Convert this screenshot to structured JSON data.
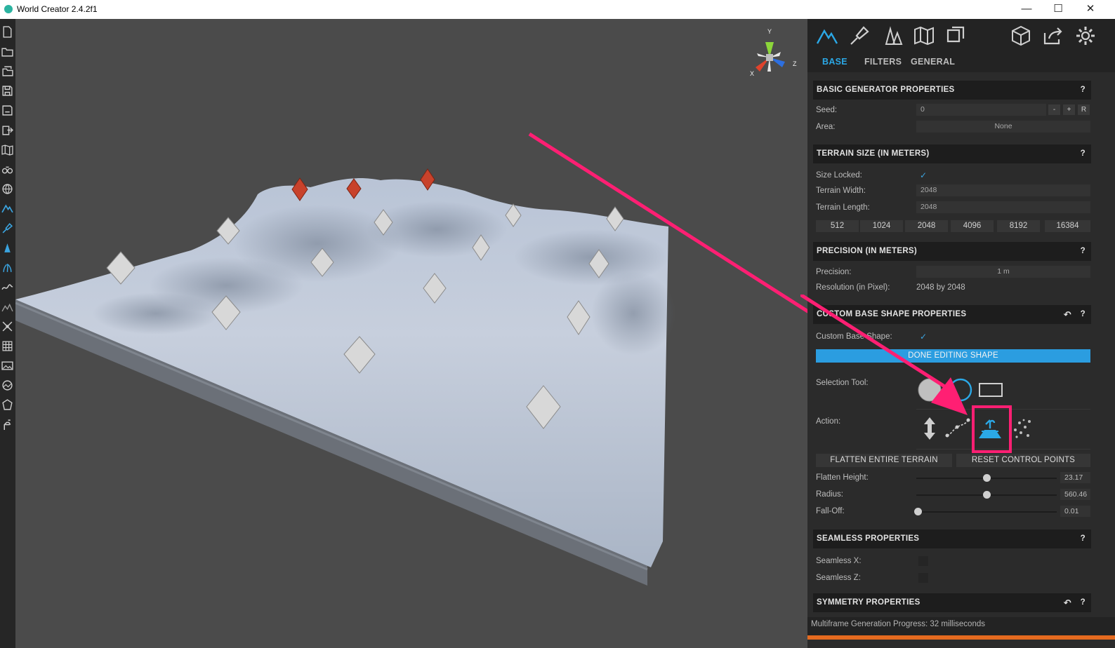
{
  "window": {
    "title": "World Creator 2.4.2f1",
    "minimize": "—",
    "maximize": "☐",
    "close": "✕"
  },
  "viewport": {
    "gizmo": {
      "y": "Y",
      "x": "X",
      "z": "Z"
    }
  },
  "panel": {
    "tabs": [
      {
        "label": "BASE",
        "active": true
      },
      {
        "label": "FILTERS",
        "active": false
      },
      {
        "label": "GENERAL",
        "active": false
      }
    ],
    "basic_generator": {
      "title": "BASIC GENERATOR PROPERTIES",
      "help": "?",
      "seed_label": "Seed:",
      "seed_value": "0",
      "seed_minus": "-",
      "seed_plus": "+",
      "seed_random": "R",
      "area_label": "Area:",
      "area_value": "None"
    },
    "terrain_size": {
      "title": "TERRAIN SIZE (IN METERS)",
      "help": "?",
      "size_locked_label": "Size Locked:",
      "size_locked": true,
      "width_label": "Terrain Width:",
      "width_value": "2048",
      "length_label": "Terrain Length:",
      "length_value": "2048",
      "presets": [
        "512",
        "1024",
        "2048",
        "4096",
        "8192",
        "16384"
      ]
    },
    "precision": {
      "title": "PRECISION (IN METERS)",
      "help": "?",
      "precision_label": "Precision:",
      "precision_value": "1 m",
      "resolution_label": "Resolution (in Pixel):",
      "resolution_value": "2048 by 2048"
    },
    "custom_base_shape": {
      "title": "CUSTOM BASE SHAPE PROPERTIES",
      "help": "?",
      "back": "↶",
      "custom_label": "Custom Base Shape:",
      "custom_checked": true,
      "done_button": "DONE EDITING SHAPE",
      "selection_tool_label": "Selection Tool:",
      "action_label": "Action:",
      "flatten_button": "FLATTEN ENTIRE TERRAIN",
      "reset_button": "RESET CONTROL POINTS",
      "flatten_height_label": "Flatten Height:",
      "flatten_height_value": "23.17",
      "flatten_height_fraction": 0.5,
      "radius_label": "Radius:",
      "radius_value": "560.46",
      "radius_fraction": 0.5,
      "falloff_label": "Fall-Off:",
      "falloff_value": "0.01",
      "falloff_fraction": 0.01
    },
    "seamless": {
      "title": "SEAMLESS PROPERTIES",
      "help": "?",
      "x_label": "Seamless X:",
      "z_label": "Seamless Z:"
    },
    "symmetry": {
      "title": "SYMMETRY PROPERTIES",
      "help": "?",
      "back": "↶"
    },
    "status": "Multiframe Generation Progress: 32 milliseconds"
  },
  "colors": {
    "accent": "#2b9de0",
    "highlight": "#ff1f73",
    "progress": "#e46a1f",
    "control_point_selected": "#c8422b"
  }
}
